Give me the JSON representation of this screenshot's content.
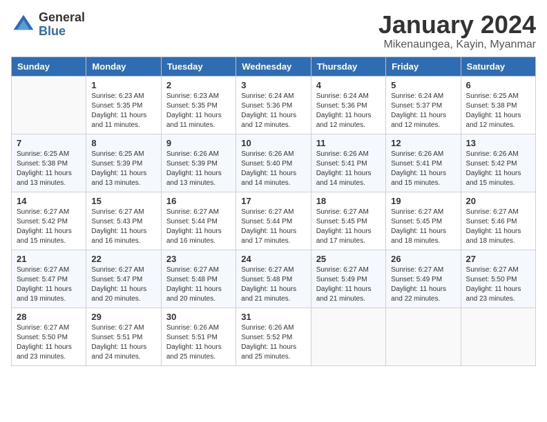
{
  "logo": {
    "general": "General",
    "blue": "Blue"
  },
  "header": {
    "month": "January 2024",
    "location": "Mikenaungea, Kayin, Myanmar"
  },
  "days_of_week": [
    "Sunday",
    "Monday",
    "Tuesday",
    "Wednesday",
    "Thursday",
    "Friday",
    "Saturday"
  ],
  "weeks": [
    [
      {
        "day": "",
        "info": ""
      },
      {
        "day": "1",
        "info": "Sunrise: 6:23 AM\nSunset: 5:35 PM\nDaylight: 11 hours\nand 11 minutes."
      },
      {
        "day": "2",
        "info": "Sunrise: 6:23 AM\nSunset: 5:35 PM\nDaylight: 11 hours\nand 11 minutes."
      },
      {
        "day": "3",
        "info": "Sunrise: 6:24 AM\nSunset: 5:36 PM\nDaylight: 11 hours\nand 12 minutes."
      },
      {
        "day": "4",
        "info": "Sunrise: 6:24 AM\nSunset: 5:36 PM\nDaylight: 11 hours\nand 12 minutes."
      },
      {
        "day": "5",
        "info": "Sunrise: 6:24 AM\nSunset: 5:37 PM\nDaylight: 11 hours\nand 12 minutes."
      },
      {
        "day": "6",
        "info": "Sunrise: 6:25 AM\nSunset: 5:38 PM\nDaylight: 11 hours\nand 12 minutes."
      }
    ],
    [
      {
        "day": "7",
        "info": "Sunrise: 6:25 AM\nSunset: 5:38 PM\nDaylight: 11 hours\nand 13 minutes."
      },
      {
        "day": "8",
        "info": "Sunrise: 6:25 AM\nSunset: 5:39 PM\nDaylight: 11 hours\nand 13 minutes."
      },
      {
        "day": "9",
        "info": "Sunrise: 6:26 AM\nSunset: 5:39 PM\nDaylight: 11 hours\nand 13 minutes."
      },
      {
        "day": "10",
        "info": "Sunrise: 6:26 AM\nSunset: 5:40 PM\nDaylight: 11 hours\nand 14 minutes."
      },
      {
        "day": "11",
        "info": "Sunrise: 6:26 AM\nSunset: 5:41 PM\nDaylight: 11 hours\nand 14 minutes."
      },
      {
        "day": "12",
        "info": "Sunrise: 6:26 AM\nSunset: 5:41 PM\nDaylight: 11 hours\nand 15 minutes."
      },
      {
        "day": "13",
        "info": "Sunrise: 6:26 AM\nSunset: 5:42 PM\nDaylight: 11 hours\nand 15 minutes."
      }
    ],
    [
      {
        "day": "14",
        "info": "Sunrise: 6:27 AM\nSunset: 5:42 PM\nDaylight: 11 hours\nand 15 minutes."
      },
      {
        "day": "15",
        "info": "Sunrise: 6:27 AM\nSunset: 5:43 PM\nDaylight: 11 hours\nand 16 minutes."
      },
      {
        "day": "16",
        "info": "Sunrise: 6:27 AM\nSunset: 5:44 PM\nDaylight: 11 hours\nand 16 minutes."
      },
      {
        "day": "17",
        "info": "Sunrise: 6:27 AM\nSunset: 5:44 PM\nDaylight: 11 hours\nand 17 minutes."
      },
      {
        "day": "18",
        "info": "Sunrise: 6:27 AM\nSunset: 5:45 PM\nDaylight: 11 hours\nand 17 minutes."
      },
      {
        "day": "19",
        "info": "Sunrise: 6:27 AM\nSunset: 5:45 PM\nDaylight: 11 hours\nand 18 minutes."
      },
      {
        "day": "20",
        "info": "Sunrise: 6:27 AM\nSunset: 5:46 PM\nDaylight: 11 hours\nand 18 minutes."
      }
    ],
    [
      {
        "day": "21",
        "info": "Sunrise: 6:27 AM\nSunset: 5:47 PM\nDaylight: 11 hours\nand 19 minutes."
      },
      {
        "day": "22",
        "info": "Sunrise: 6:27 AM\nSunset: 5:47 PM\nDaylight: 11 hours\nand 20 minutes."
      },
      {
        "day": "23",
        "info": "Sunrise: 6:27 AM\nSunset: 5:48 PM\nDaylight: 11 hours\nand 20 minutes."
      },
      {
        "day": "24",
        "info": "Sunrise: 6:27 AM\nSunset: 5:48 PM\nDaylight: 11 hours\nand 21 minutes."
      },
      {
        "day": "25",
        "info": "Sunrise: 6:27 AM\nSunset: 5:49 PM\nDaylight: 11 hours\nand 21 minutes."
      },
      {
        "day": "26",
        "info": "Sunrise: 6:27 AM\nSunset: 5:49 PM\nDaylight: 11 hours\nand 22 minutes."
      },
      {
        "day": "27",
        "info": "Sunrise: 6:27 AM\nSunset: 5:50 PM\nDaylight: 11 hours\nand 23 minutes."
      }
    ],
    [
      {
        "day": "28",
        "info": "Sunrise: 6:27 AM\nSunset: 5:50 PM\nDaylight: 11 hours\nand 23 minutes."
      },
      {
        "day": "29",
        "info": "Sunrise: 6:27 AM\nSunset: 5:51 PM\nDaylight: 11 hours\nand 24 minutes."
      },
      {
        "day": "30",
        "info": "Sunrise: 6:26 AM\nSunset: 5:51 PM\nDaylight: 11 hours\nand 25 minutes."
      },
      {
        "day": "31",
        "info": "Sunrise: 6:26 AM\nSunset: 5:52 PM\nDaylight: 11 hours\nand 25 minutes."
      },
      {
        "day": "",
        "info": ""
      },
      {
        "day": "",
        "info": ""
      },
      {
        "day": "",
        "info": ""
      }
    ]
  ]
}
